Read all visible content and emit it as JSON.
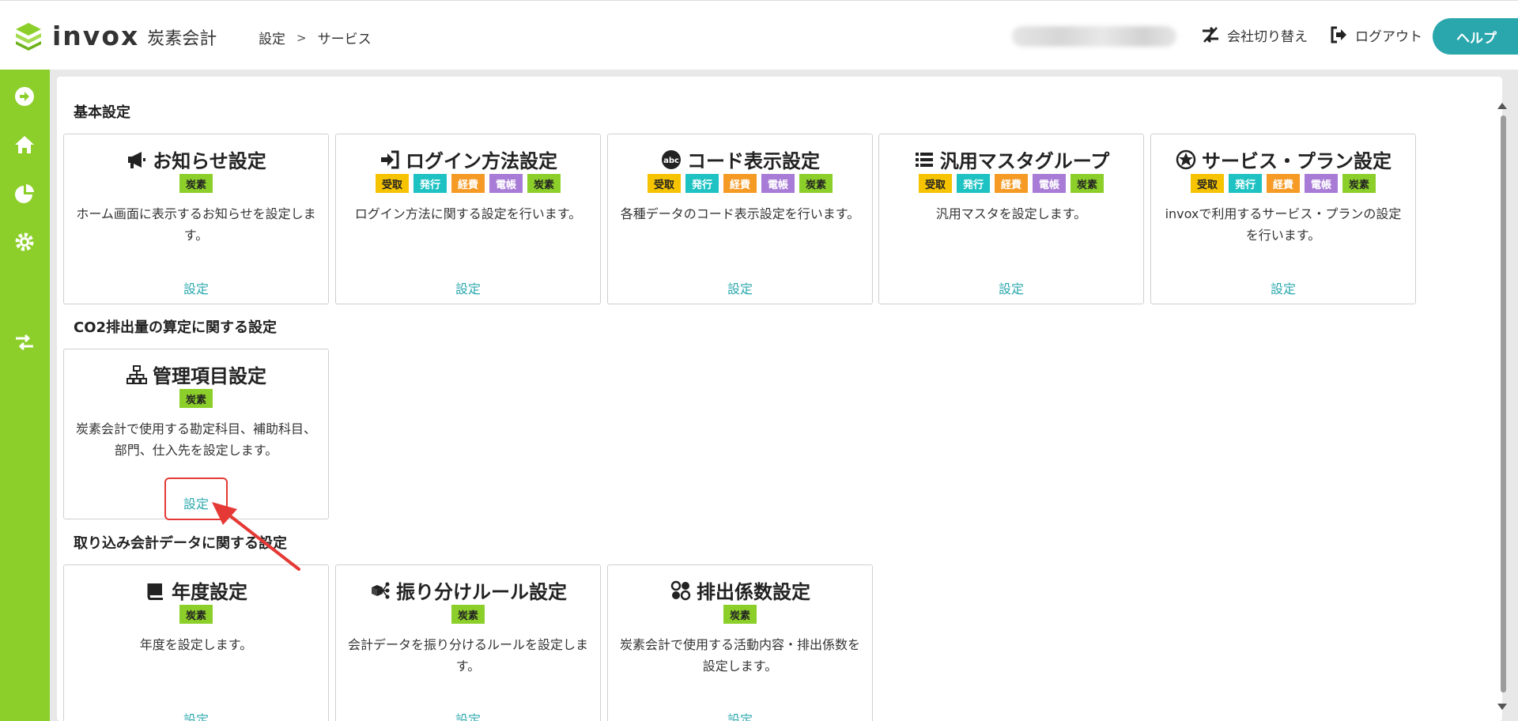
{
  "header": {
    "logo_word": "invox",
    "logo_sub": "炭素会計",
    "breadcrumb": [
      "設定",
      "サービス"
    ],
    "switch_company": "会社切り替え",
    "logout": "ログアウト",
    "help": "ヘルプ"
  },
  "sidebar": {
    "icons": [
      "arrow-circle-right-icon",
      "home-icon",
      "pie-chart-icon",
      "gear-icon",
      "switch-arrows-icon"
    ]
  },
  "colors": {
    "accent_green": "#8ccf2a",
    "teal": "#2aa7ad",
    "tag_juryo": "#f5c300",
    "tag_hakko": "#1fc2c2",
    "tag_keihi": "#f59a24",
    "tag_denchou": "#a87bd6",
    "tag_tanso": "#8ccf2a",
    "highlight_red": "#e53935"
  },
  "sections": [
    {
      "title": "基本設定",
      "cards": [
        {
          "title": "お知らせ設定",
          "icon": "megaphone-icon",
          "tags": [
            "炭素"
          ],
          "desc": "ホーム画面に表示するお知らせを設定します。",
          "link": "設定"
        },
        {
          "title": "ログイン方法設定",
          "icon": "sign-in-icon",
          "tags": [
            "受取",
            "発行",
            "経費",
            "電帳",
            "炭素"
          ],
          "desc": "ログイン方法に関する設定を行います。",
          "link": "設定"
        },
        {
          "title": "コード表示設定",
          "icon": "abc-icon",
          "tags": [
            "受取",
            "発行",
            "経費",
            "電帳",
            "炭素"
          ],
          "desc": "各種データのコード表示設定を行います。",
          "link": "設定"
        },
        {
          "title": "汎用マスタグループ",
          "icon": "list-icon",
          "tags": [
            "受取",
            "発行",
            "経費",
            "電帳",
            "炭素"
          ],
          "desc": "汎用マスタを設定します。",
          "link": "設定"
        },
        {
          "title": "サービス・プラン設定",
          "icon": "star-badge-icon",
          "tags": [
            "受取",
            "発行",
            "経費",
            "電帳",
            "炭素"
          ],
          "desc": "invoxで利用するサービス・プランの設定を行います。",
          "link": "設定"
        }
      ]
    },
    {
      "title": "CO2排出量の算定に関する設定",
      "cards": [
        {
          "title": "管理項目設定",
          "icon": "org-chart-icon",
          "tags": [
            "炭素"
          ],
          "desc": "炭素会計で使用する勘定科目、補助科目、部門、仕入先を設定します。",
          "link": "設定"
        }
      ]
    },
    {
      "title": "取り込み会計データに関する設定",
      "cards": [
        {
          "title": "年度設定",
          "icon": "book-icon",
          "tags": [
            "炭素"
          ],
          "desc": "年度を設定します。",
          "link": "設定"
        },
        {
          "title": "振り分けルール設定",
          "icon": "branch-icon",
          "tags": [
            "炭素"
          ],
          "desc": "会計データを振り分けるルールを設定します。",
          "link": "設定"
        },
        {
          "title": "排出係数設定",
          "icon": "grid-circles-icon",
          "tags": [
            "炭素"
          ],
          "desc": "炭素会計で使用する活動内容・排出係数を設定します。",
          "link": "設定"
        }
      ]
    }
  ]
}
